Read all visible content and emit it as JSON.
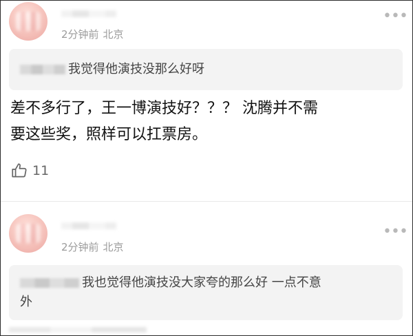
{
  "comments": [
    {
      "time": "2分钟前",
      "location": "北京",
      "more_label": "•••",
      "quote": "我觉得他演技没那么好呀",
      "body_lines": [
        "差不多行了，王一博演技好？？？ 沈腾并不需",
        "要这些奖，照样可以扛票房。"
      ],
      "like_count": "11",
      "like_icon": "thumbs-up-icon"
    },
    {
      "time": "2分钟前",
      "location": "北京",
      "more_label": "•••",
      "quote_lines": [
        "我也觉得他演技没大家夸的那么好  一点不意",
        "外"
      ]
    }
  ],
  "colors": {
    "meta": "#9b9b9b",
    "quote_bg": "#f3f3f3",
    "avatar": "#f0b3ad",
    "frame_border": "#2b2b2b"
  }
}
